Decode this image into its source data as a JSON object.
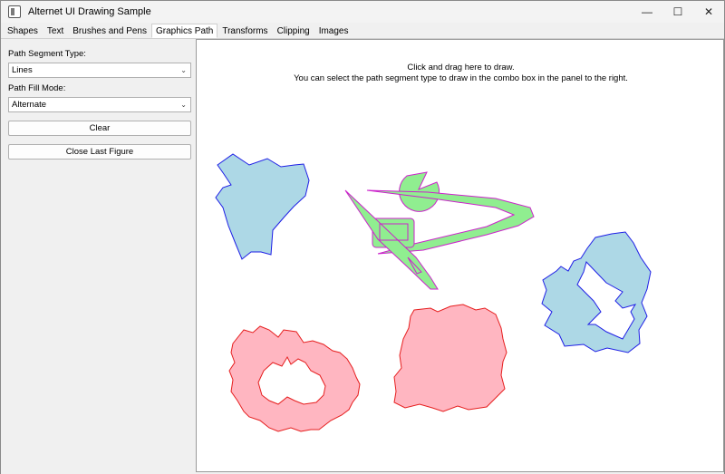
{
  "window": {
    "title": "Alternet UI Drawing Sample"
  },
  "tabs": [
    {
      "label": "Shapes"
    },
    {
      "label": "Text"
    },
    {
      "label": "Brushes and Pens"
    },
    {
      "label": "Graphics Path"
    },
    {
      "label": "Transforms"
    },
    {
      "label": "Clipping"
    },
    {
      "label": "Images"
    }
  ],
  "active_tab": "Graphics Path",
  "panel": {
    "segment_type_label": "Path Segment Type:",
    "segment_type_value": "Lines",
    "fill_mode_label": "Path Fill Mode:",
    "fill_mode_value": "Alternate",
    "clear_button": "Clear",
    "close_figure_button": "Close Last Figure"
  },
  "canvas": {
    "instruction_line1": "Click and drag here to draw.",
    "instruction_line2": "You can select the path segment type to draw in the combo box in the panel to the right."
  },
  "colors": {
    "blue_fill": "#add8e6",
    "blue_stroke": "#1e1ee6",
    "green_fill": "#90ee90",
    "magenta_stroke": "#cc22cc",
    "pink_fill": "#ffb6c1",
    "red_stroke": "#e61e1e"
  }
}
